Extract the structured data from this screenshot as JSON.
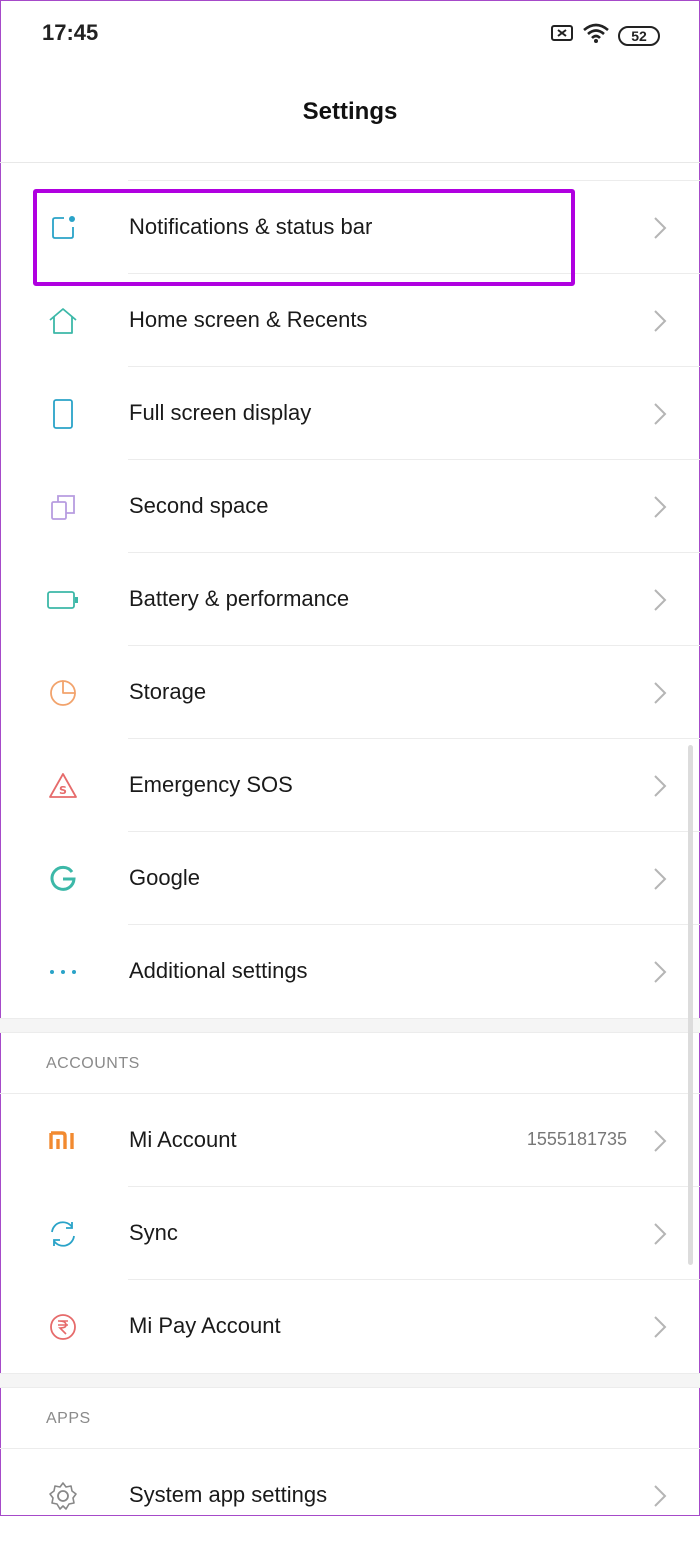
{
  "status_bar": {
    "time": "17:45",
    "battery": "52",
    "icons": [
      "sim-none-icon",
      "wifi-icon",
      "battery-icon"
    ]
  },
  "header": {
    "title": "Settings"
  },
  "highlight_color": "#b000e0",
  "groups": [
    {
      "items": [
        {
          "label": "Notifications & status bar",
          "icon": "notification-icon",
          "color": "#2aa3c8"
        },
        {
          "label": "Home screen & Recents",
          "icon": "home-icon",
          "color": "#3cb8a8"
        },
        {
          "label": "Full screen display",
          "icon": "phone-icon",
          "color": "#2aa3c8"
        },
        {
          "label": "Second space",
          "icon": "second-space-icon",
          "color": "#b79ce0"
        },
        {
          "label": "Battery & performance",
          "icon": "battery-perf-icon",
          "color": "#3cb8a8"
        },
        {
          "label": "Storage",
          "icon": "storage-pie-icon",
          "color": "#f2a36c"
        },
        {
          "label": "Emergency SOS",
          "icon": "sos-icon",
          "color": "#e66b6b"
        },
        {
          "label": "Google",
          "icon": "google-icon",
          "color": "#3cb8a8"
        },
        {
          "label": "Additional settings",
          "icon": "more-dots-icon",
          "color": "#2aa3c8"
        }
      ]
    },
    {
      "header": "ACCOUNTS",
      "items": [
        {
          "label": "Mi Account",
          "value": "1555181735",
          "icon": "mi-logo-icon",
          "color": "#f28a30"
        },
        {
          "label": "Sync",
          "icon": "sync-icon",
          "color": "#2aa3c8"
        },
        {
          "label": "Mi Pay Account",
          "icon": "rupee-icon",
          "color": "#e66b6b"
        }
      ]
    },
    {
      "header": "APPS",
      "items": [
        {
          "label": "System app settings",
          "icon": "gear-icon",
          "color": "#888888"
        }
      ]
    }
  ]
}
